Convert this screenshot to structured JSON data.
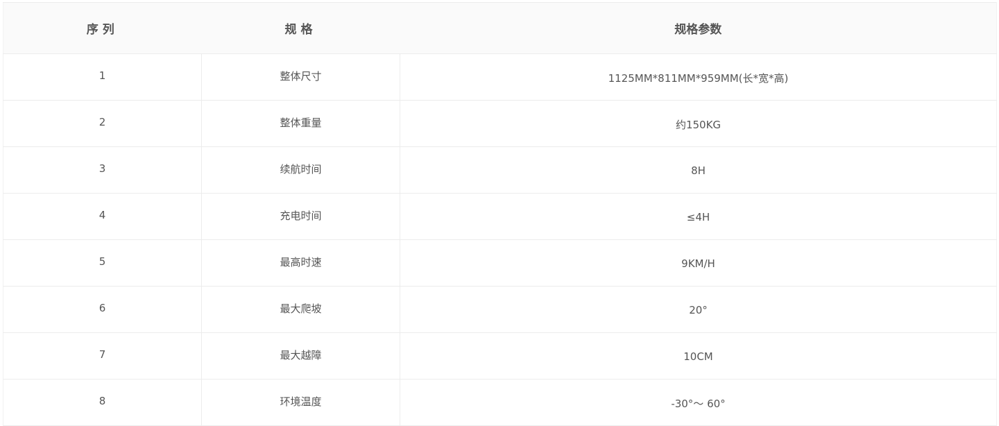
{
  "table": {
    "headers": [
      "序列",
      "规格",
      "规格参数"
    ],
    "rows": [
      [
        "1",
        "整体尺寸",
        "1125MM*811MM*959MM(长*宽*高)"
      ],
      [
        "2",
        "整体重量",
        "约150KG"
      ],
      [
        "3",
        "续航时间",
        "8H"
      ],
      [
        "4",
        "充电时间",
        "≤4H"
      ],
      [
        "5",
        "最高时速",
        "9KM/H"
      ],
      [
        "6",
        "最大爬坡",
        "20°"
      ],
      [
        "7",
        "最大越障",
        "10CM"
      ],
      [
        "8",
        "环境温度",
        "-30°～ 60°"
      ]
    ]
  }
}
